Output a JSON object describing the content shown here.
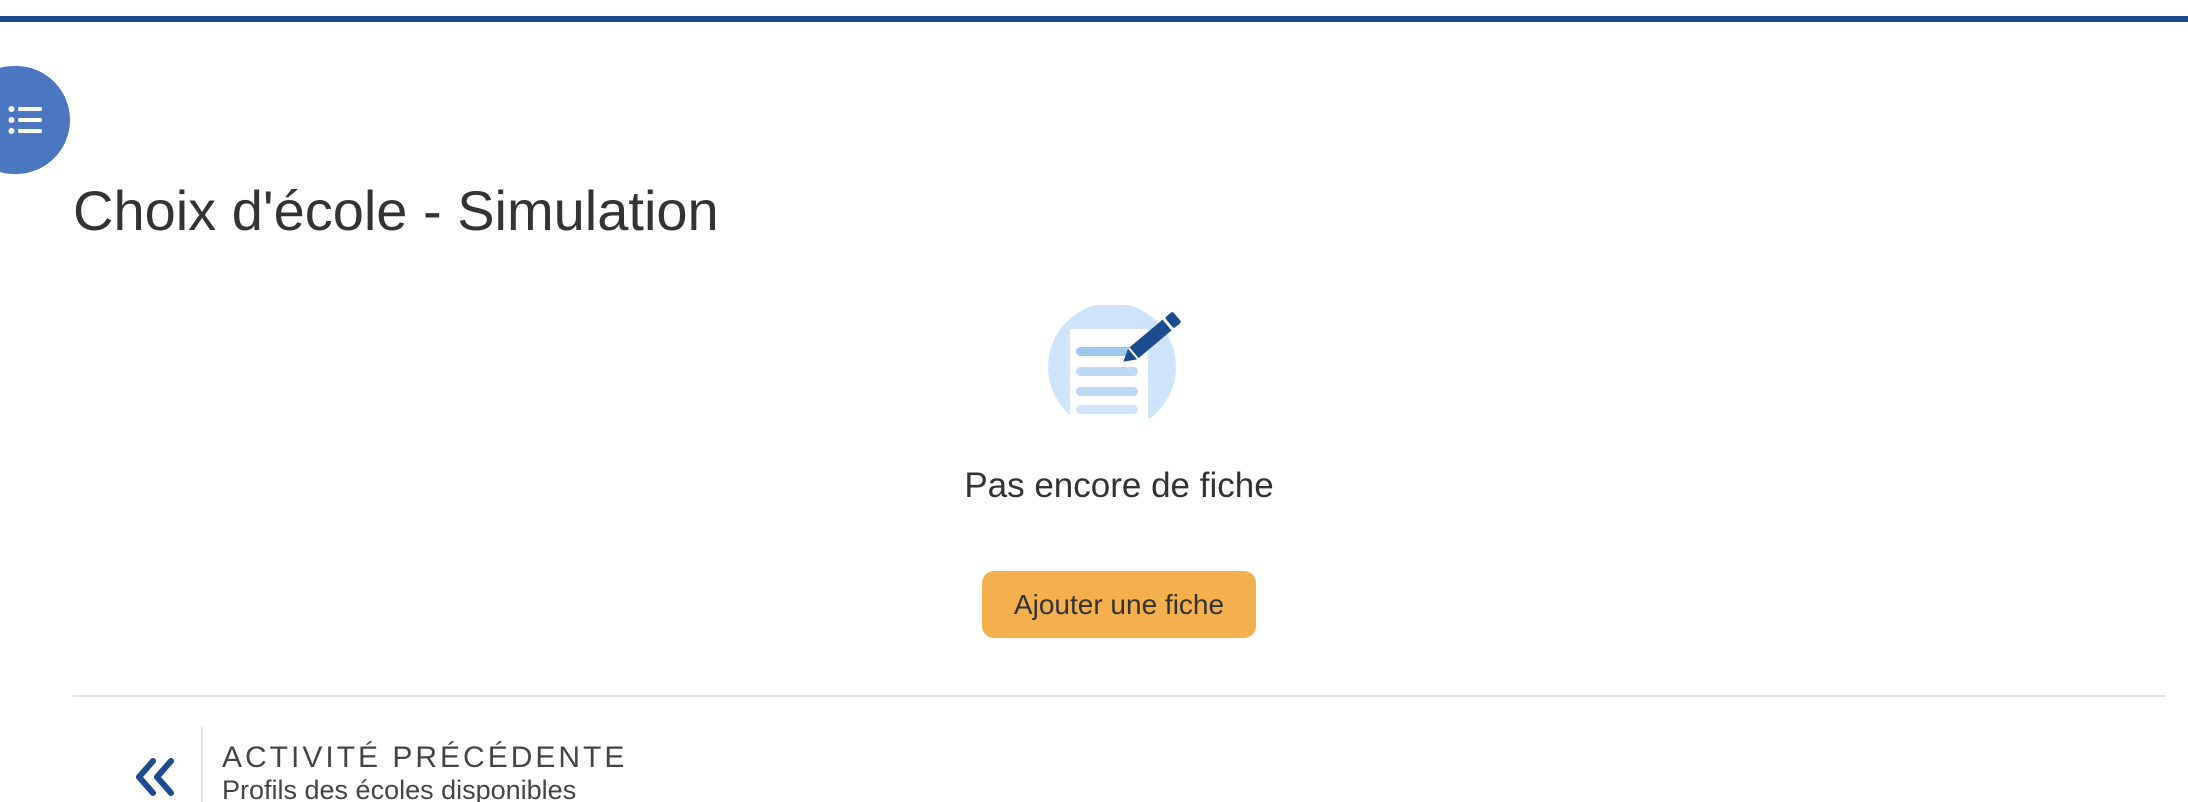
{
  "header": {
    "accent_color": "#1d4b8f",
    "toc_toggle_icon": "list-icon",
    "toc_toggle_color": "#4a77c0"
  },
  "main": {
    "title": "Choix d'école - Simulation",
    "empty_state": {
      "icon": "document-edit-icon",
      "text": "Pas encore de fiche",
      "button_label": "Ajouter une fiche",
      "button_color": "#f4b04d"
    }
  },
  "navigation": {
    "previous": {
      "icon": "double-chevron-left-icon",
      "label": "ACTIVITÉ PRÉCÉDENTE",
      "title": "Profils des écoles disponibles"
    }
  }
}
